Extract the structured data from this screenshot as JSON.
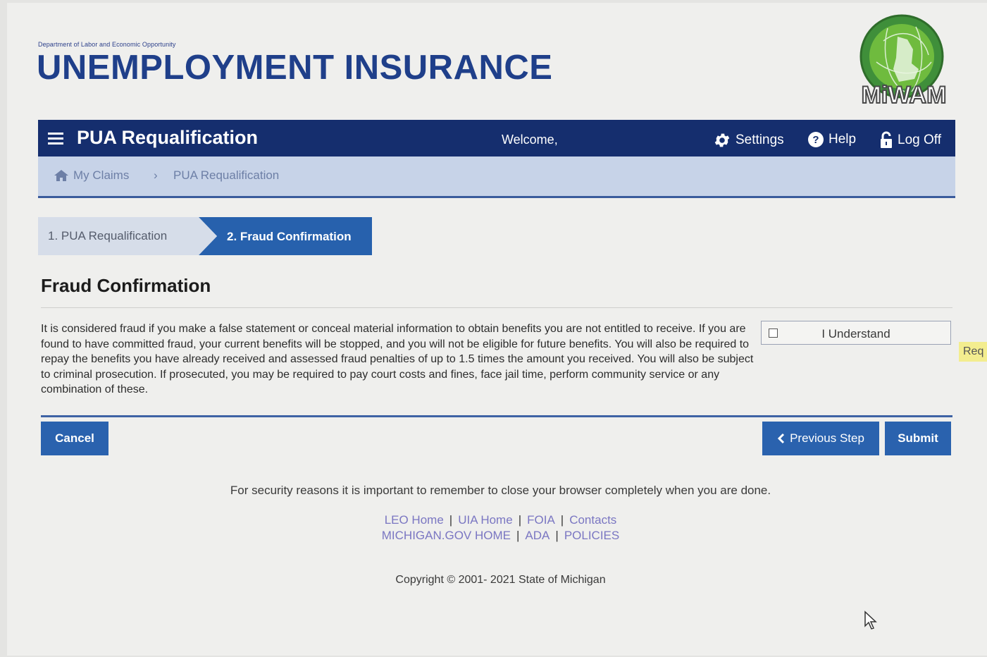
{
  "header": {
    "department": "Department of Labor and Economic Opportunity",
    "title": "UNEMPLOYMENT INSURANCE",
    "logo_text": "MiWAM"
  },
  "navbar": {
    "title": "PUA Requalification",
    "welcome": "Welcome,",
    "settings": "Settings",
    "help": "Help",
    "logoff": "Log Off"
  },
  "breadcrumb": {
    "home": "My Claims",
    "separator": "›",
    "current": "PUA Requalification"
  },
  "steps": [
    {
      "label": "1. PUA Requalification",
      "active": false
    },
    {
      "label": "2. Fraud Confirmation",
      "active": true
    }
  ],
  "main": {
    "heading": "Fraud Confirmation",
    "body": "It is considered fraud if you make a false statement or conceal material information to obtain benefits you are not entitled to receive. If you are found to have committed fraud, your current benefits will be stopped, and you will not be eligible for future benefits. You will also be required to repay the benefits you have already received and assessed fraud penalties of up to 1.5 times the amount you received. You will also be subject to criminal prosecution. If prosecuted, you may be required to pay court costs and fines, face jail time, perform community service or any combination of these.",
    "checkbox_label": "I Understand",
    "checkbox_checked": false,
    "required_flag": "Req"
  },
  "buttons": {
    "cancel": "Cancel",
    "previous": "Previous Step",
    "submit": "Submit"
  },
  "footer": {
    "security_note": "For security reasons it is important to remember to close your browser completely when you are done.",
    "links_row1": [
      "LEO Home",
      "UIA Home",
      "FOIA",
      "Contacts"
    ],
    "links_row2": [
      "MICHIGAN.GOV HOME",
      "ADA",
      "POLICIES"
    ],
    "separator": "|",
    "copyright": "Copyright © 2001- 2021 State of Michigan"
  },
  "colors": {
    "navbar": "#152e6e",
    "primary_button": "#2a62ae",
    "brand_blue": "#1f3f8a",
    "link": "#7a76c2"
  }
}
